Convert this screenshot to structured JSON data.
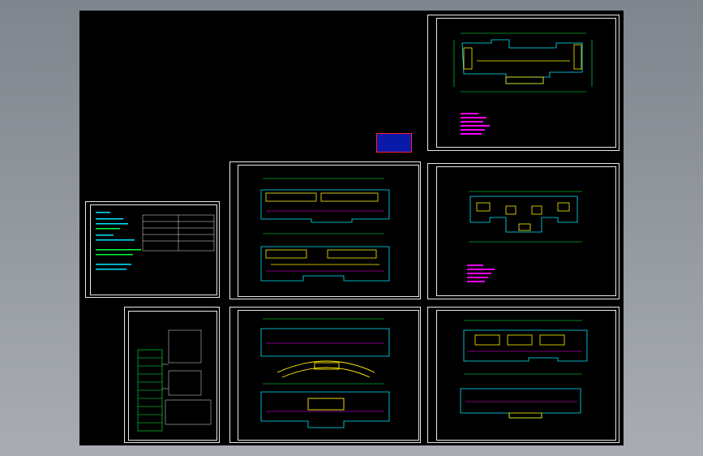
{
  "colors": {
    "background": "#000000",
    "frame": "#e8e8e8",
    "cyan": "#00e8ff",
    "green": "#00ff40",
    "yellow": "#ffee00",
    "magenta": "#ff00ff",
    "red": "#ff2030",
    "white": "#ffffff"
  },
  "stamp": {
    "line1": "",
    "line2": ""
  },
  "sheets": [
    {
      "id": "sheet-top-right",
      "label": ""
    },
    {
      "id": "sheet-mid-right",
      "label": ""
    },
    {
      "id": "sheet-mid-center",
      "label": ""
    },
    {
      "id": "sheet-left-notes",
      "label": ""
    },
    {
      "id": "sheet-left-diagram",
      "label": ""
    },
    {
      "id": "sheet-bottom-center",
      "label": ""
    },
    {
      "id": "sheet-bottom-right",
      "label": ""
    }
  ]
}
